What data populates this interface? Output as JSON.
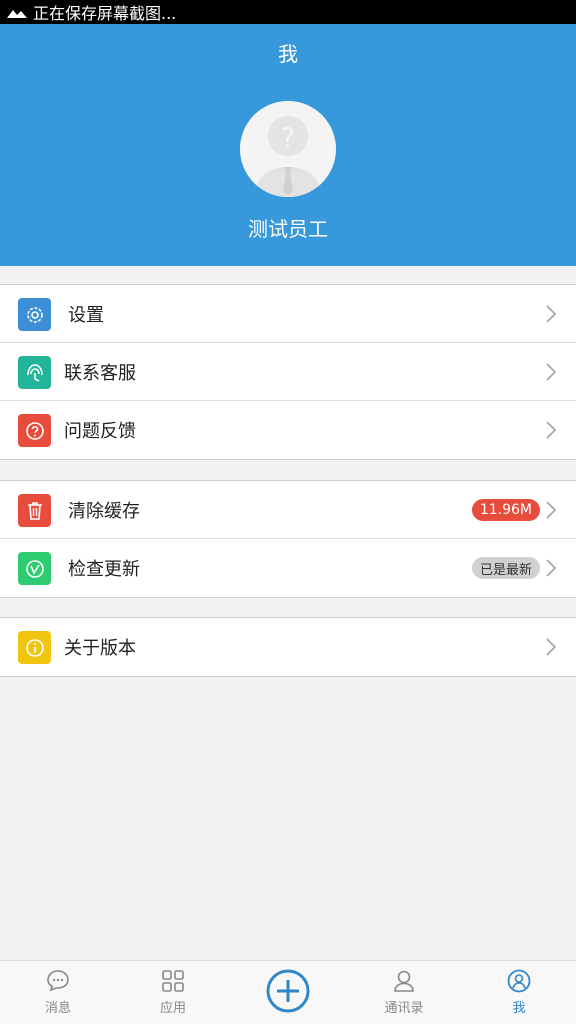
{
  "status_bar": {
    "text": "正在保存屏幕截图..."
  },
  "header": {
    "title": "我",
    "user_name": "测试员工"
  },
  "menu_groups": [
    {
      "items": [
        {
          "label": "设置",
          "icon": "gear-icon",
          "color": "#3c8fd6"
        },
        {
          "label": "联系客服",
          "icon": "headset-icon",
          "color": "#23b59a"
        },
        {
          "label": "问题反馈",
          "icon": "question-icon",
          "color": "#e74c3c"
        }
      ]
    },
    {
      "items": [
        {
          "label": "清除缓存",
          "icon": "trash-icon",
          "color": "#e74c3c",
          "badge": "11.96M"
        },
        {
          "label": "检查更新",
          "icon": "update-icon",
          "color": "#2ecc71",
          "badge": "已是最新"
        }
      ]
    },
    {
      "items": [
        {
          "label": "关于版本",
          "icon": "info-icon",
          "color": "#f1c40f"
        }
      ]
    }
  ],
  "tabbar": {
    "tabs": [
      {
        "label": "消息",
        "icon": "chat-icon"
      },
      {
        "label": "应用",
        "icon": "grid-icon"
      },
      {
        "label": "",
        "icon": "add-icon"
      },
      {
        "label": "通讯录",
        "icon": "contacts-icon"
      },
      {
        "label": "我",
        "icon": "profile-icon",
        "active": true
      }
    ],
    "active_color": "#2f86c8"
  }
}
